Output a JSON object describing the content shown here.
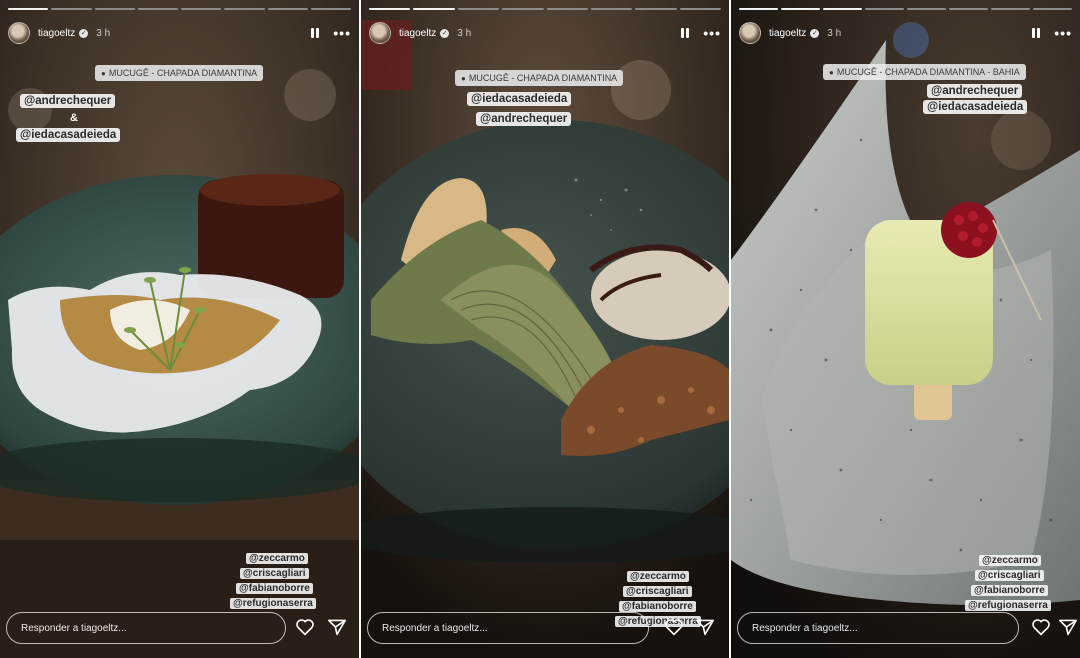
{
  "stories": [
    {
      "username": "tiagoeltz",
      "verified_mark": "✓",
      "time": "3 h",
      "more_glyph": "•••",
      "progress_total": 8,
      "progress_done": 1,
      "location": "MUCUGÊ - CHAPADA DIAMANTINA",
      "mentions": [
        "@andrechequer",
        "&",
        "@iedacasadeieda"
      ],
      "tags": [
        "@zeccarmo",
        "@criscagliari",
        "@fabianoborre",
        "@refugionaserra"
      ],
      "reply_placeholder": "Responder a tiagoeltz..."
    },
    {
      "username": "tiagoeltz",
      "verified_mark": "✓",
      "time": "3 h",
      "more_glyph": "•••",
      "progress_total": 8,
      "progress_done": 2,
      "location": "MUCUGÊ - CHAPADA DIAMANTINA",
      "mentions": [
        "@iedacasadeieda",
        "@andrechequer"
      ],
      "tags": [
        "@zeccarmo",
        "@criscagliari",
        "@fabianoborre",
        "@refugionaserra"
      ],
      "reply_placeholder": "Responder a tiagoeltz..."
    },
    {
      "username": "tiagoeltz",
      "verified_mark": "✓",
      "time": "3 h",
      "more_glyph": "•••",
      "progress_total": 8,
      "progress_done": 3,
      "location": "MUCUGÊ - CHAPADA DIAMANTINA - BAHIA",
      "mentions": [
        "@andrechequer",
        "@iedacasadeieda"
      ],
      "tags": [
        "@zeccarmo",
        "@criscagliari",
        "@fabianoborre",
        "@refugionaserra"
      ],
      "reply_placeholder": "Responder a tiagoeltz..."
    }
  ],
  "icons": {
    "pause": "pause-icon",
    "more": "more-icon",
    "location": "location-pin-icon",
    "like": "heart-icon",
    "share": "send-icon"
  },
  "colors": {
    "progress_done": "#f2f2f2",
    "progress_pending": "#8c8c8c",
    "sticker_bg": "#f0f0f0",
    "sticker_text": "#2b2b2b"
  }
}
